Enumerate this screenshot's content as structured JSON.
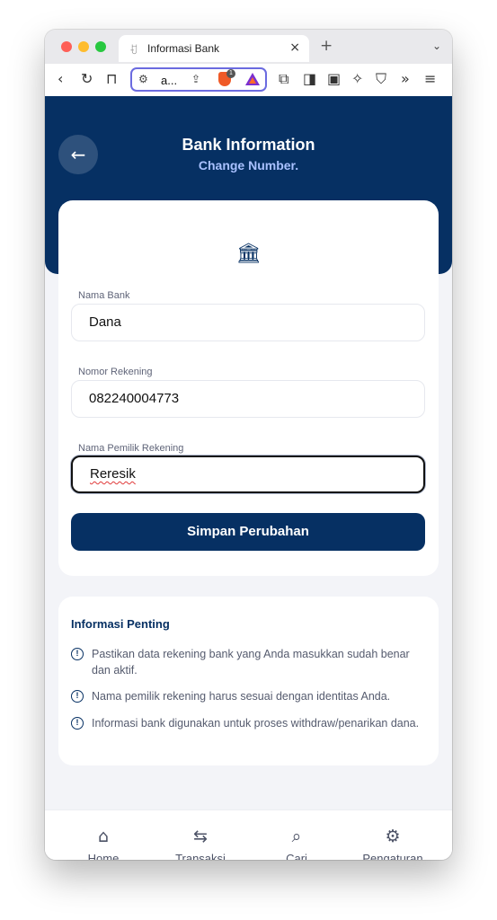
{
  "browser": {
    "tab_icon": "ꀀ",
    "tab_title": "Informasi Bank",
    "tab_close": "×",
    "new_tab": "+",
    "tab_menu": "⌄",
    "url_text": "a...",
    "brave_badge": "1"
  },
  "header": {
    "back_icon": "←",
    "title": "Bank Information",
    "subtitle": "Change Number."
  },
  "form": {
    "bank_icon": "🏛",
    "bank_name_label": "Nama Bank",
    "bank_name_value": "Dana",
    "account_number_label": "Nomor Rekening",
    "account_number_value": "082240004773",
    "account_holder_label": "Nama Pemilik Rekening",
    "account_holder_value": "Reresik",
    "save_label": "Simpan Perubahan"
  },
  "info": {
    "title": "Informasi Penting",
    "icon": "!",
    "items": [
      "Pastikan data rekening bank yang Anda masukkan sudah benar dan aktif.",
      "Nama pemilik rekening harus sesuai dengan identitas Anda.",
      "Informasi bank digunakan untuk proses withdraw/penarikan dana."
    ]
  },
  "nav": {
    "items": [
      {
        "label": "Home",
        "icon": "home-icon"
      },
      {
        "label": "Transaksi",
        "icon": "swap-icon"
      },
      {
        "label": "Cari",
        "icon": "search-icon"
      },
      {
        "label": "Pengaturan",
        "icon": "gear-icon"
      }
    ]
  },
  "colors": {
    "primary": "#063063",
    "accent_subtitle": "#a9c1ff",
    "background": "#f3f4f8"
  }
}
